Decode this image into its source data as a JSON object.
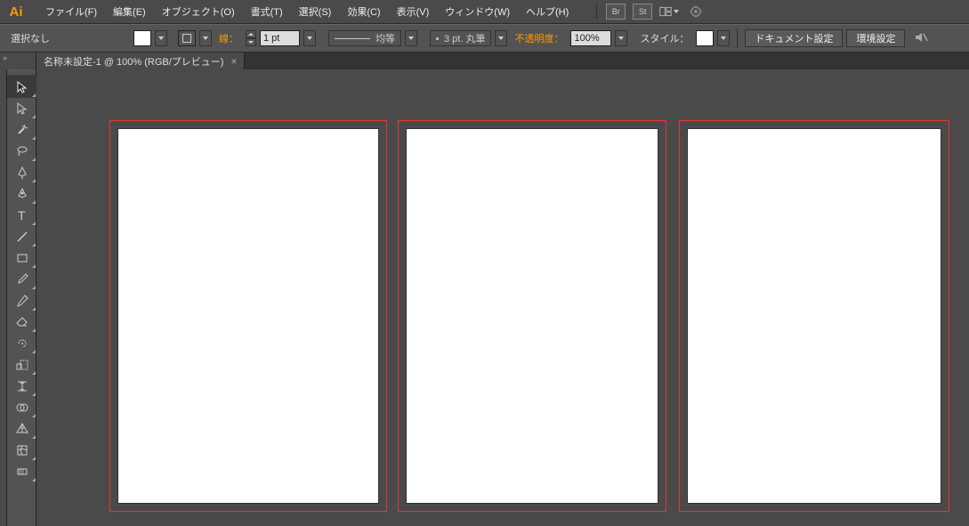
{
  "app": {
    "logo": "Ai"
  },
  "menu": {
    "items": [
      "ファイル(F)",
      "編集(E)",
      "オブジェクト(O)",
      "書式(T)",
      "選択(S)",
      "効果(C)",
      "表示(V)",
      "ウィンドウ(W)",
      "ヘルプ(H)"
    ],
    "icons": {
      "br": "Br",
      "st": "St"
    }
  },
  "control": {
    "selection": "選択なし",
    "stroke_label": "線：",
    "stroke_value": "1 pt",
    "profile_label": "均等",
    "brush_label": "3 pt. 丸筆",
    "opacity_label": "不透明度：",
    "opacity_value": "100%",
    "style_label": "スタイル：",
    "doc_setup": "ドキュメント設定",
    "prefs": "環境設定"
  },
  "tab": {
    "title": "名称未設定-1 @ 100% (RGB/プレビュー)",
    "close": "×"
  },
  "tools": [
    "selection",
    "direct-selection",
    "magic-wand",
    "lasso",
    "pen",
    "curvature",
    "type",
    "line",
    "rectangle",
    "paintbrush",
    "pencil",
    "eraser",
    "rotate",
    "width",
    "free-transform",
    "shape-builder",
    "perspective",
    "mesh",
    "gradient"
  ],
  "artboards": {
    "count": 3
  }
}
